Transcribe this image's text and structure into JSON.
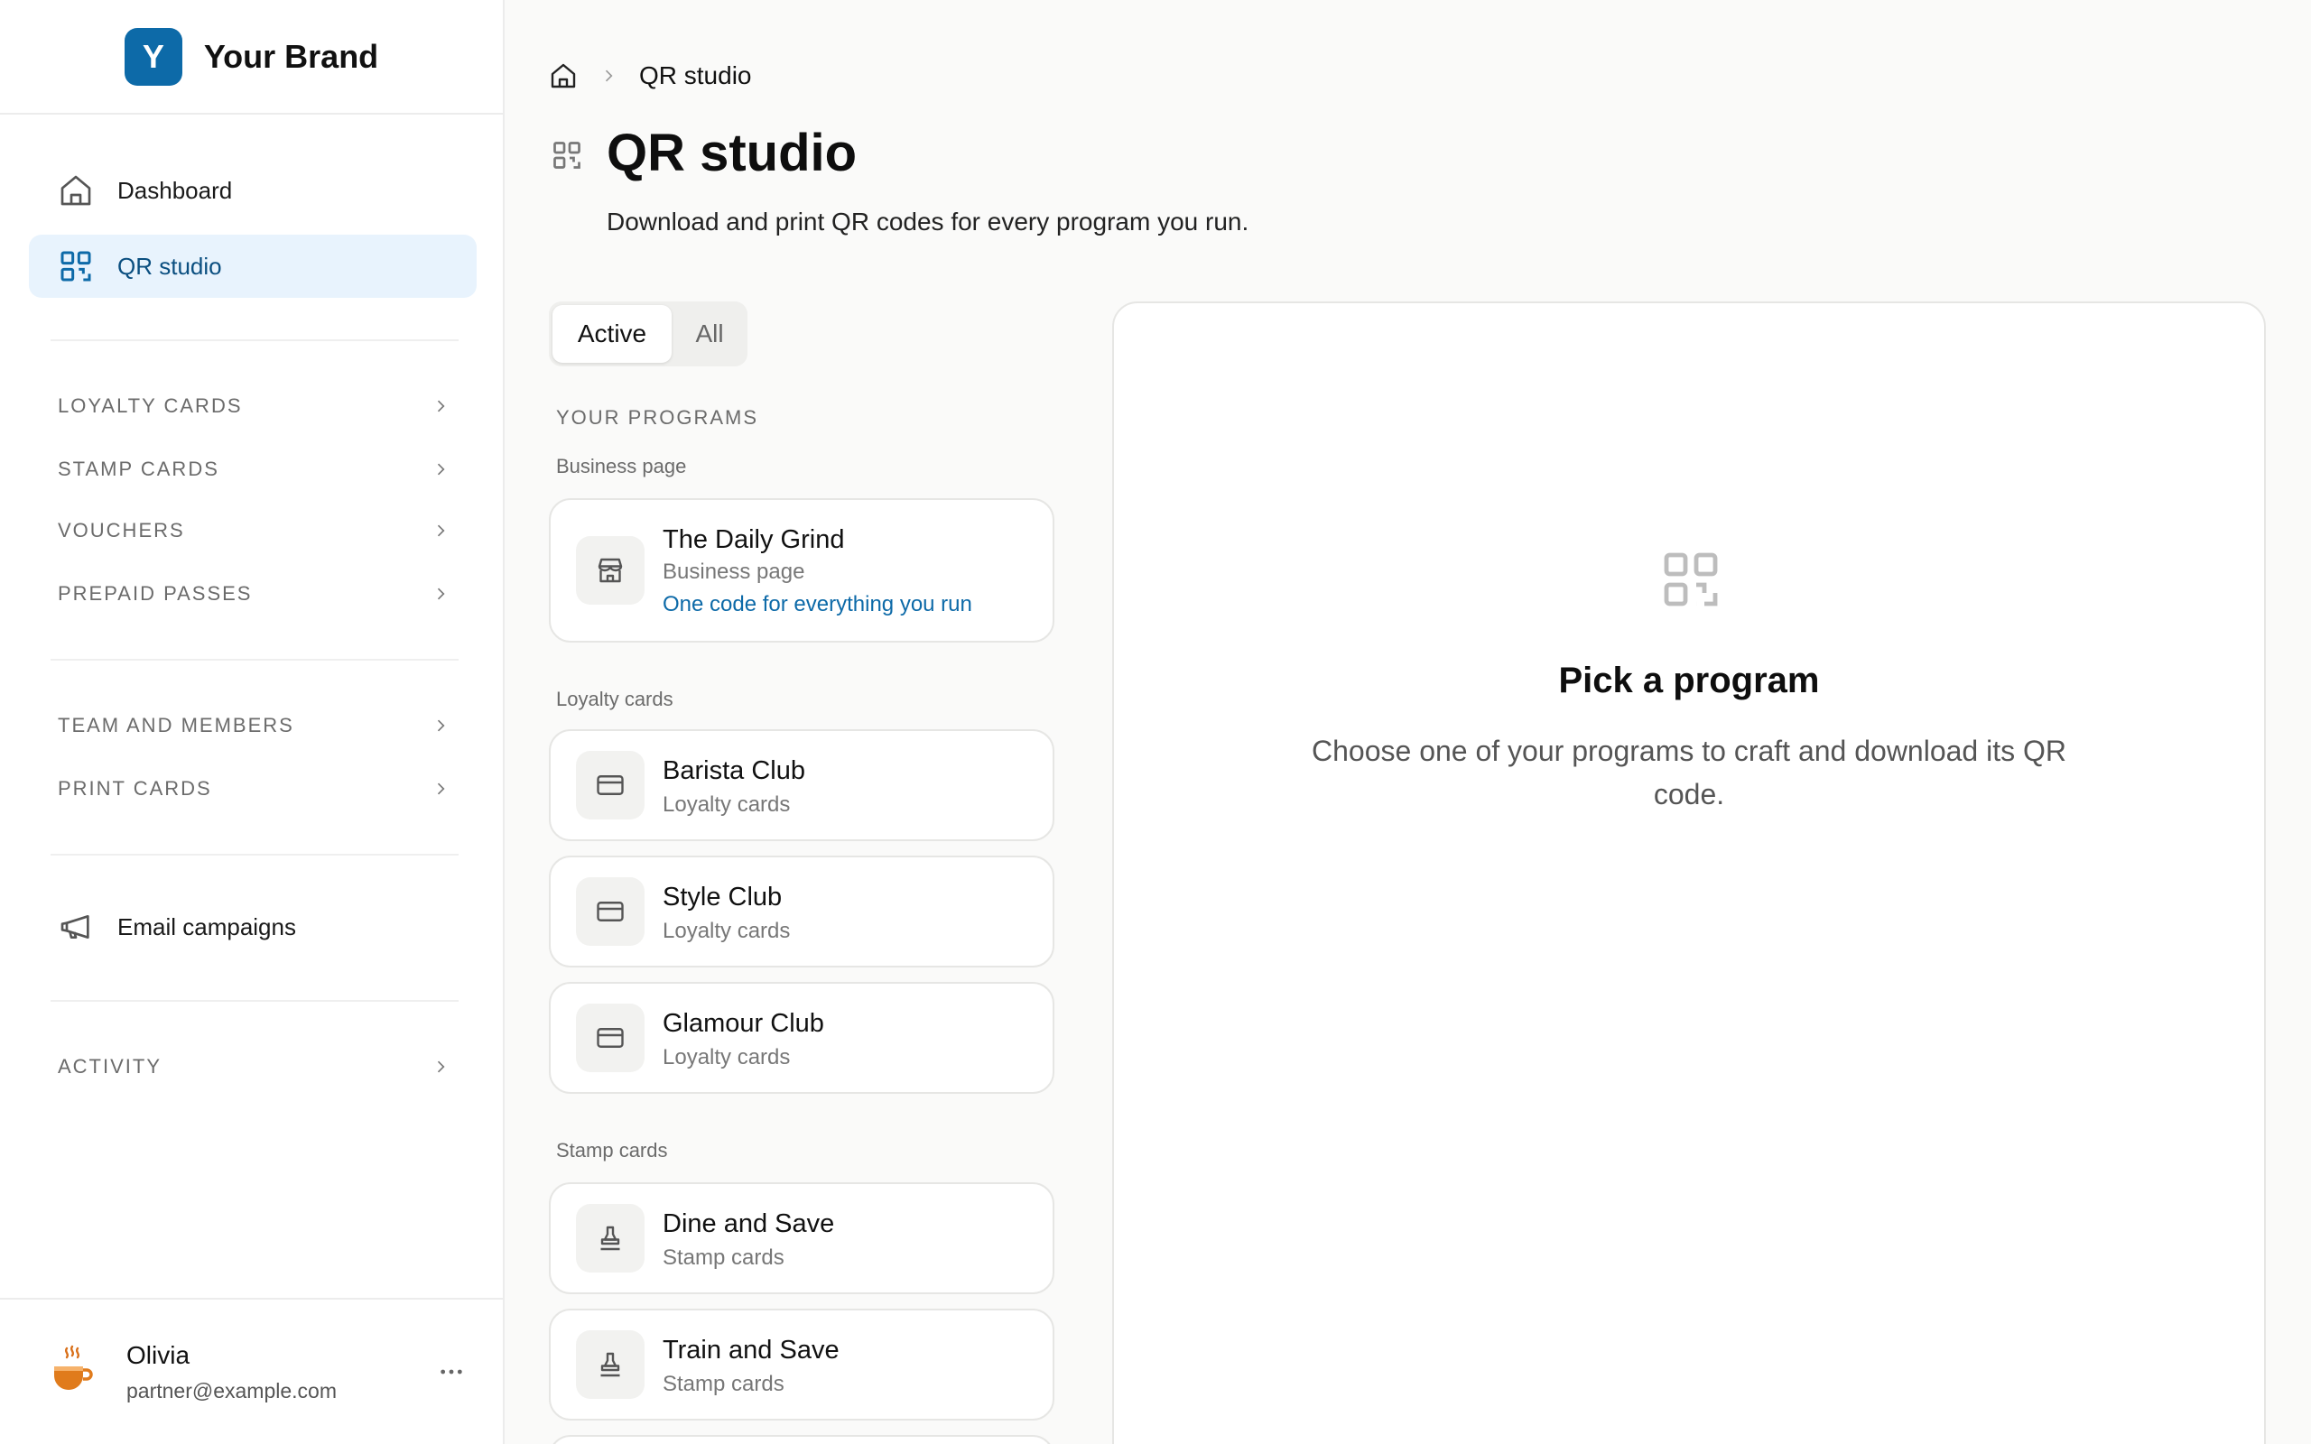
{
  "brand": {
    "initial": "Y",
    "name": "Your Brand"
  },
  "sidebar": {
    "primary": [
      {
        "label": "Dashboard",
        "icon": "home-icon"
      },
      {
        "label": "QR studio",
        "icon": "qr-code-icon",
        "active": true
      }
    ],
    "sections": [
      {
        "label": "LOYALTY CARDS"
      },
      {
        "label": "STAMP CARDS"
      },
      {
        "label": "VOUCHERS"
      },
      {
        "label": "PREPAID PASSES"
      },
      {
        "label": "TEAM AND MEMBERS"
      },
      {
        "label": "PRINT CARDS"
      },
      {
        "label": "ACTIVITY"
      }
    ],
    "email_campaigns": {
      "label": "Email campaigns",
      "icon": "megaphone-icon"
    }
  },
  "user": {
    "name": "Olivia",
    "email": "partner@example.com",
    "avatar": "coffee-cup-icon"
  },
  "breadcrumb": {
    "current": "QR studio"
  },
  "page": {
    "title": "QR studio",
    "subtitle": "Download and print QR codes for every program you run."
  },
  "tabs": {
    "active": "Active",
    "all": "All"
  },
  "programs": {
    "heading": "YOUR PROGRAMS",
    "groups": [
      {
        "label": "Business page",
        "items": [
          {
            "name": "The Daily Grind",
            "type": "Business page",
            "note": "One code for everything you run",
            "icon": "store-icon"
          }
        ]
      },
      {
        "label": "Loyalty cards",
        "items": [
          {
            "name": "Barista Club",
            "type": "Loyalty cards",
            "icon": "card-icon"
          },
          {
            "name": "Style Club",
            "type": "Loyalty cards",
            "icon": "card-icon"
          },
          {
            "name": "Glamour Club",
            "type": "Loyalty cards",
            "icon": "card-icon"
          }
        ]
      },
      {
        "label": "Stamp cards",
        "items": [
          {
            "name": "Dine and Save",
            "type": "Stamp cards",
            "icon": "stamp-icon"
          },
          {
            "name": "Train and Save",
            "type": "Stamp cards",
            "icon": "stamp-icon"
          }
        ]
      }
    ]
  },
  "detail": {
    "title": "Pick a program",
    "text": "Choose one of your programs to craft and download its QR code.",
    "icon": "qr-code-icon"
  },
  "colors": {
    "accent": "#0d6aa8",
    "active_bg": "#e8f3fd",
    "background": "#fafaf9"
  }
}
